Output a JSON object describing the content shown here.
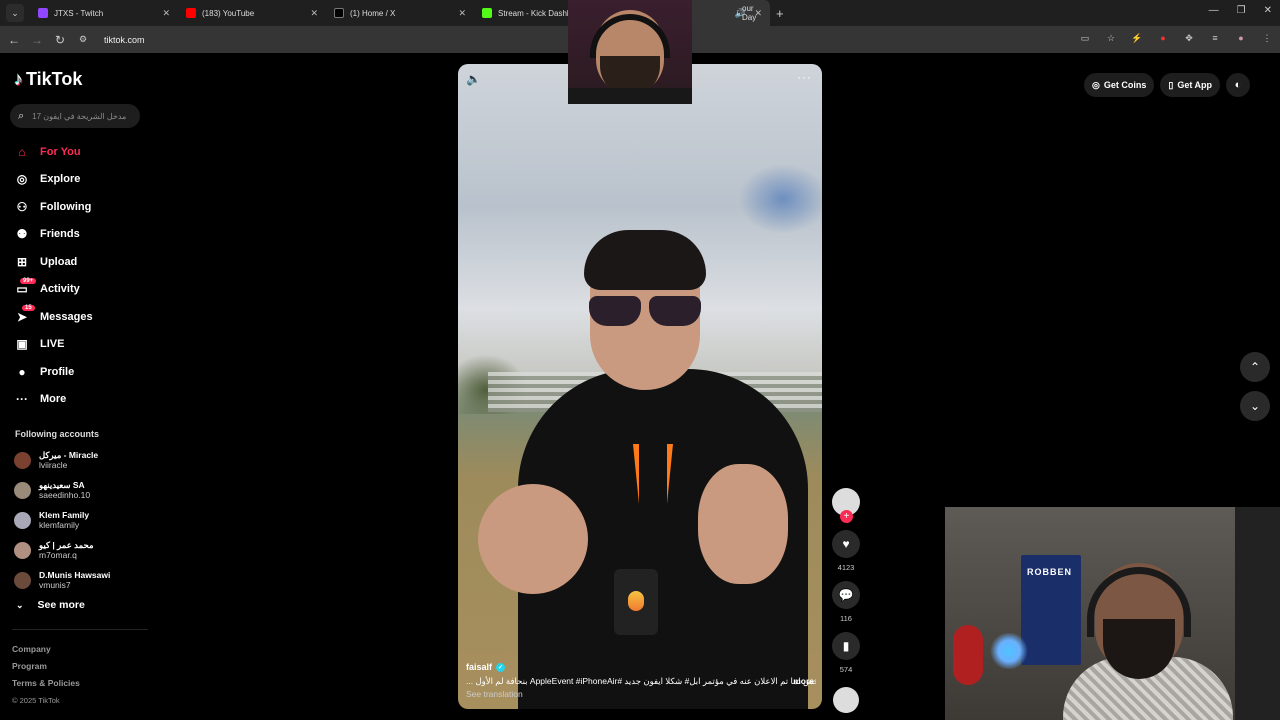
{
  "browser": {
    "tabs": [
      {
        "label": "JTXS - Twitch",
        "color": "#9146ff"
      },
      {
        "label": "(183) YouTube",
        "color": "#ff0000"
      },
      {
        "label": "(1) Home / X",
        "color": "#000000"
      },
      {
        "label": "Stream - Kick Dashboar",
        "color": "#53fc18"
      },
      {
        "label": "our Day",
        "color": "#444444"
      }
    ],
    "url": "tiktok.com"
  },
  "app": {
    "name": "TikTok",
    "accent": "#fe2c55"
  },
  "search": {
    "placeholder": "مدخل الشريحة في ايفون 17"
  },
  "nav": {
    "items": [
      {
        "label": "For You",
        "icon": "home-icon",
        "active": true
      },
      {
        "label": "Explore",
        "icon": "compass-icon"
      },
      {
        "label": "Following",
        "icon": "user-follow-icon"
      },
      {
        "label": "Friends",
        "icon": "friends-icon"
      },
      {
        "label": "Upload",
        "icon": "plus-square-icon"
      },
      {
        "label": "Activity",
        "icon": "inbox-icon",
        "badge": "99+"
      },
      {
        "label": "Messages",
        "icon": "send-icon",
        "badge": "15"
      },
      {
        "label": "LIVE",
        "icon": "live-icon"
      },
      {
        "label": "Profile",
        "icon": "avatar-icon"
      },
      {
        "label": "More",
        "icon": "more-icon"
      }
    ]
  },
  "following_accounts": {
    "title": "Following accounts",
    "items": [
      {
        "name": "ميركل - Miracle",
        "handle": "lviiracle"
      },
      {
        "name": "سعيدينهو SA",
        "handle": "saeedinho.10"
      },
      {
        "name": "Klem Family",
        "handle": "klemfamily"
      },
      {
        "name": "محمد عمر | كيو",
        "handle": "m7omar.q"
      },
      {
        "name": "D.Munis Hawsawi",
        "handle": "vmunis7"
      }
    ],
    "see_more": "See more"
  },
  "footer": {
    "links": [
      "Company",
      "Program",
      "Terms & Policies"
    ],
    "copyright": "© 2025 TikTok"
  },
  "header": {
    "get_coins": "Get Coins",
    "get_app": "Get App"
  },
  "video": {
    "username": "faisalf",
    "caption": "ملخص لما تم الاعلان عنه في مؤتمر ابل# شكلا ايفون جديد #AppleEvent #iPhoneAir بنحافة لم الأول ...",
    "more": "more",
    "see_translation": "See translation"
  },
  "actions": {
    "likes": "4123",
    "comments": "116",
    "saves": "574"
  }
}
